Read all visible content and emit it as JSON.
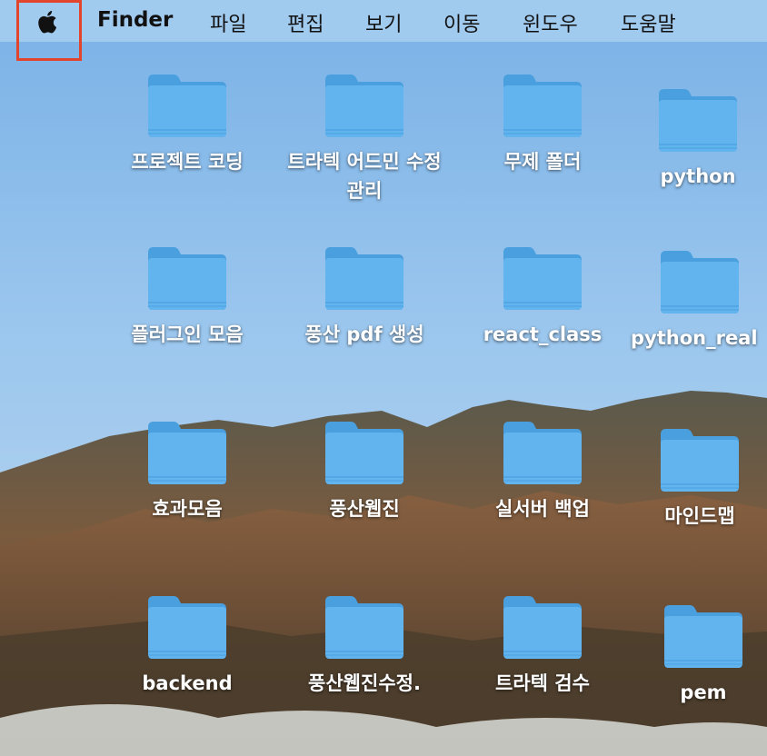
{
  "menubar": {
    "app_name": "Finder",
    "items": [
      "파일",
      "편집",
      "보기",
      "이동",
      "윈도우",
      "도움말"
    ],
    "apple_icon": "apple-logo-icon"
  },
  "desktop": {
    "folder_icon": "folder-icon",
    "folders": [
      {
        "label": "프로젝트 코딩"
      },
      {
        "label": "트라텍 어드민 수정 관리"
      },
      {
        "label": "무제 폴더"
      },
      {
        "label": "python"
      },
      {
        "label": "플러그인 모음"
      },
      {
        "label": "풍산 pdf 생성"
      },
      {
        "label": "react_class"
      },
      {
        "label": "python_real"
      },
      {
        "label": "효과모음"
      },
      {
        "label": "풍산웹진"
      },
      {
        "label": "실서버 백업"
      },
      {
        "label": "마인드맵"
      },
      {
        "label": "backend"
      },
      {
        "label": "풍산웹진수정."
      },
      {
        "label": "트라텍 검수"
      },
      {
        "label": "pem"
      }
    ]
  },
  "colors": {
    "folder_front": "#62b4ee",
    "folder_back": "#4a9fdf",
    "highlight_box": "#e2452b"
  }
}
